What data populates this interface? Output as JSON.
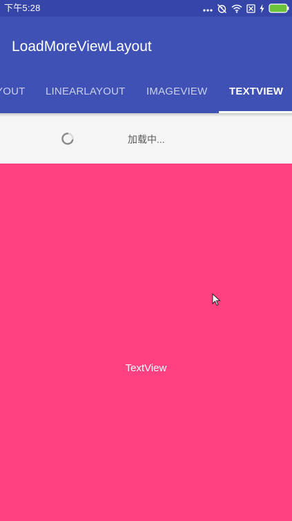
{
  "status_bar": {
    "time": "下午5:28",
    "icons": [
      "more-dots-icon",
      "alarm-off-icon",
      "wifi-icon",
      "sim-off-icon",
      "charging-bolt-icon",
      "battery-icon"
    ],
    "background": "#3546a8"
  },
  "app_bar": {
    "title": "LoadMoreViewLayout",
    "background": "#3f51b5"
  },
  "tabs": [
    {
      "label": "YOUT",
      "active": false
    },
    {
      "label": "LINEARLAYOUT",
      "active": false
    },
    {
      "label": "IMAGEVIEW",
      "active": false
    },
    {
      "label": "TEXTVIEW",
      "active": true
    }
  ],
  "loading": {
    "text": "加载中..."
  },
  "content": {
    "label": "TextView",
    "background": "#ff4081"
  },
  "colors": {
    "primary": "#3f51b5",
    "primary_dark": "#3546a8",
    "accent": "#ff4081",
    "battery": "#6cc33a"
  }
}
